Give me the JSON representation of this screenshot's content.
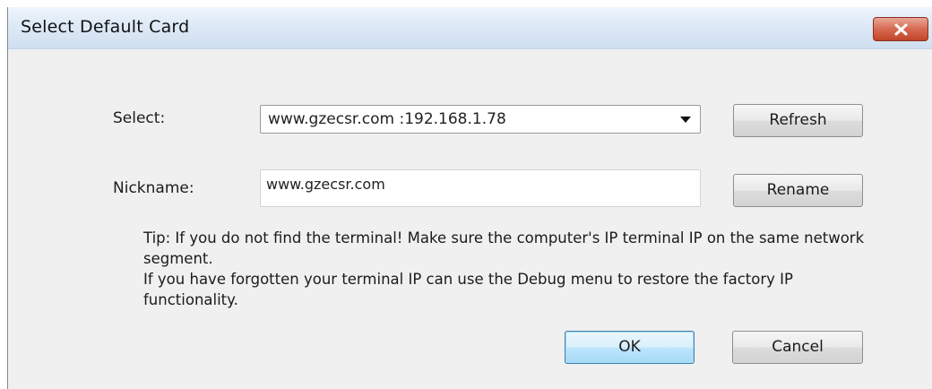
{
  "window": {
    "title": "Select Default Card"
  },
  "form": {
    "select_label": "Select:",
    "select_value": "www.gzecsr.com :192.168.1.78",
    "nickname_label": "Nickname:",
    "nickname_value": "www.gzecsr.com"
  },
  "buttons": {
    "refresh": "Refresh",
    "rename": "Rename",
    "ok": "OK",
    "cancel": "Cancel"
  },
  "tip": {
    "line1": "Tip: If you do not find the terminal! Make sure the computer's IP terminal IP on the same network segment.",
    "line2": " If you have forgotten your terminal IP can use the Debug menu to restore the factory IP functionality."
  },
  "icons": {
    "close": "close-icon",
    "dropdown": "chevron-down-icon"
  },
  "colors": {
    "close_button": "#c9503a",
    "titlebar": "#dde9f6",
    "dialog_bg": "#f0f0f0",
    "ok_border": "#3c7fb1"
  }
}
